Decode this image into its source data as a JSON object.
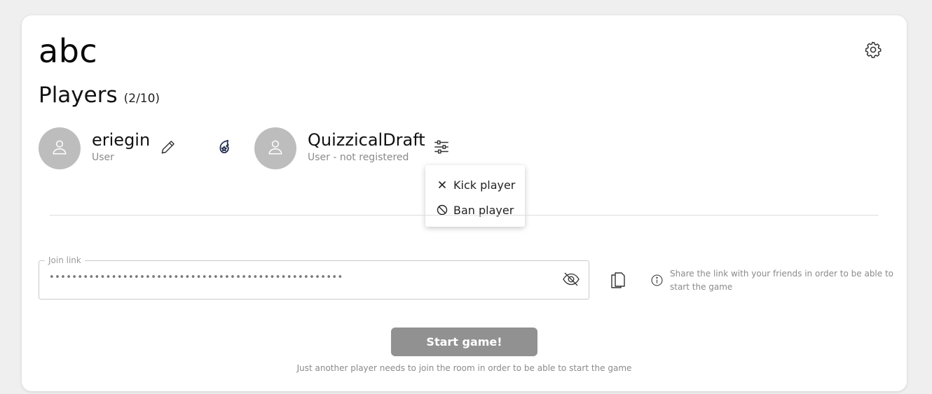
{
  "room": {
    "title": "abc"
  },
  "players_section": {
    "label": "Players",
    "count": "(2/10)"
  },
  "players": [
    {
      "name": "eriegin",
      "role": "User"
    },
    {
      "name": "QuizzicalDraft",
      "role": "User - not registered"
    }
  ],
  "player_menu": {
    "kick_label": "Kick player",
    "ban_label": "Ban player"
  },
  "join_link": {
    "legend": "Join link",
    "value": "••••••••••••••••••••••••••••••••••••••••••••••••••••"
  },
  "share_info": {
    "text": "Share the link with your friends in order to be able to start the game"
  },
  "start": {
    "button_label": "Start game!",
    "hint": "Just another player needs to join the room in order to be able to start the game"
  },
  "colors": {
    "navy_accent": "#1b2a4a",
    "button_disabled": "#919191"
  },
  "icons": [
    "gear-icon",
    "user-icon",
    "pencil-icon",
    "crown-shield-icon",
    "sliders-icon",
    "close-icon",
    "ban-icon",
    "eye-off-icon",
    "copy-icon",
    "info-icon"
  ]
}
